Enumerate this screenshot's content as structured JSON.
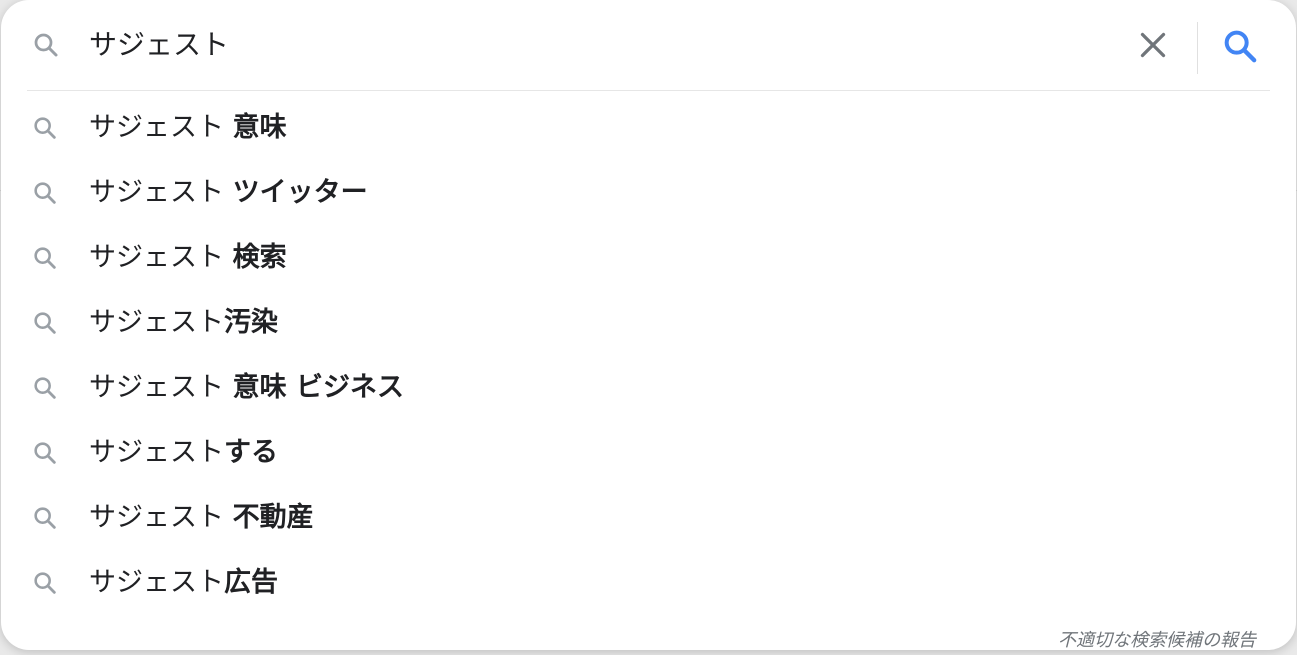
{
  "search": {
    "query": "サジェスト"
  },
  "suggestions": [
    {
      "prefix": "サジェスト ",
      "rest": "意味"
    },
    {
      "prefix": "サジェスト ",
      "rest": "ツイッター"
    },
    {
      "prefix": "サジェスト ",
      "rest": "検索"
    },
    {
      "prefix": "サジェスト",
      "rest": "汚染"
    },
    {
      "prefix": "サジェスト ",
      "rest": "意味 ビジネス"
    },
    {
      "prefix": "サジェスト",
      "rest": "する"
    },
    {
      "prefix": "サジェスト ",
      "rest": "不動産"
    },
    {
      "prefix": "サジェスト",
      "rest": "広告"
    }
  ],
  "report_link": "不適切な検索候補の報告",
  "icons": {
    "left": "search-icon",
    "clear": "close-icon",
    "submit": "search-icon",
    "suggestion": "search-icon"
  },
  "colors": {
    "submit_icon": "#4285f4",
    "muted_icon": "#9aa0a6",
    "clear_icon": "#70757a"
  }
}
